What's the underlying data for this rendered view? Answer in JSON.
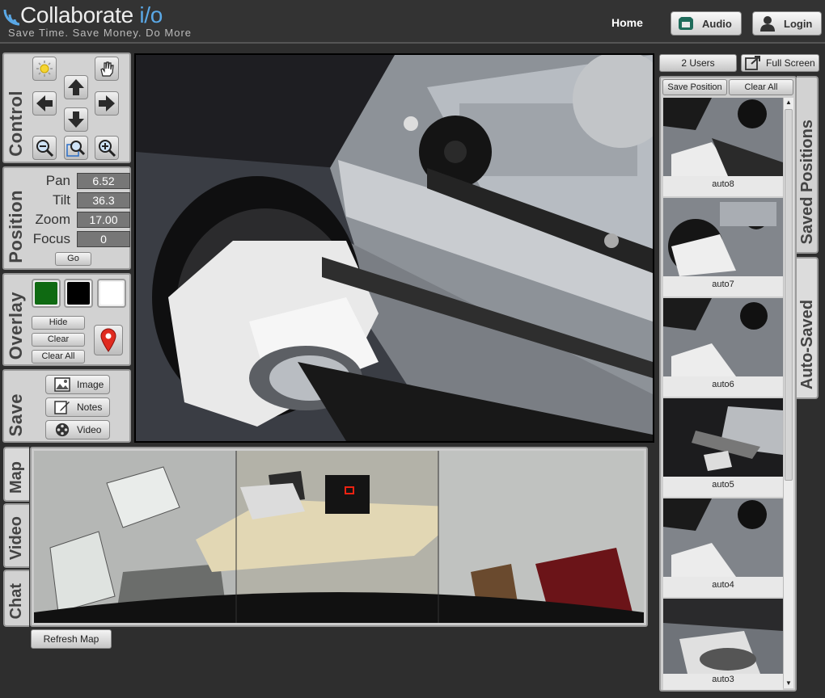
{
  "header": {
    "logo_main": "Collaborate",
    "logo_suffix": "i/o",
    "tagline": "Save Time. Save Money. Do More",
    "nav_home": "Home",
    "audio_label": "Audio",
    "login_label": "Login"
  },
  "control": {
    "title": "Control",
    "icons": [
      "brightness-icon",
      "hand-pan-icon",
      "arrow-up-icon",
      "arrow-left-icon",
      "arrow-right-icon",
      "arrow-down-icon",
      "zoom-out-icon",
      "zoom-area-icon",
      "zoom-in-icon"
    ]
  },
  "position": {
    "title": "Position",
    "rows": [
      {
        "label": "Pan",
        "value": "6.52"
      },
      {
        "label": "Tilt",
        "value": "36.3"
      },
      {
        "label": "Zoom",
        "value": "17.00"
      },
      {
        "label": "Focus",
        "value": "0"
      }
    ],
    "go_label": "Go"
  },
  "overlay": {
    "title": "Overlay",
    "colors": [
      "#0f6a12",
      "#000000",
      "#ffffff"
    ],
    "hide_label": "Hide",
    "clear_label": "Clear",
    "clear_all_label": "Clear All"
  },
  "save": {
    "title": "Save",
    "image_label": "Image",
    "notes_label": "Notes",
    "video_label": "Video"
  },
  "left_tabs": {
    "map": "Map",
    "video": "Video",
    "chat": "Chat"
  },
  "refresh_map_label": "Refresh Map",
  "right": {
    "users_label": "2 Users",
    "fullscreen_label": "Full Screen",
    "save_position_label": "Save Position",
    "clear_all_label": "Clear All",
    "tab_saved": "Saved Positions",
    "tab_auto": "Auto-Saved",
    "thumbnails": [
      "auto8",
      "auto7",
      "auto6",
      "auto5",
      "auto4",
      "auto3"
    ]
  }
}
